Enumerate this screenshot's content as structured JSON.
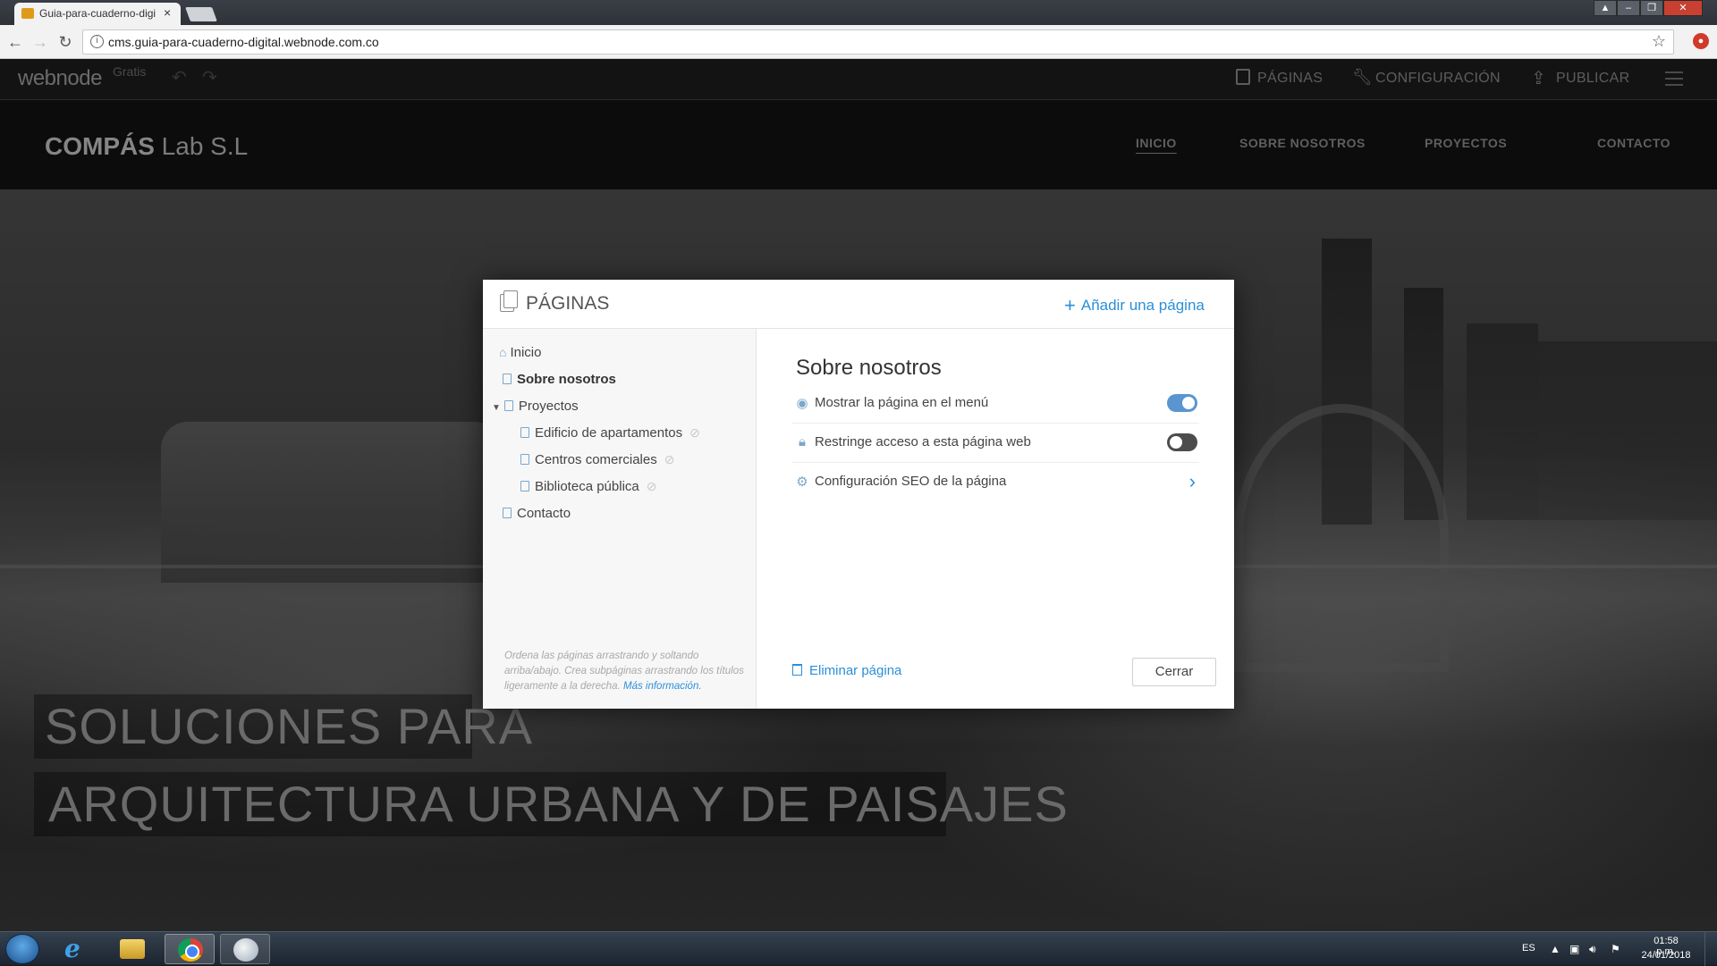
{
  "browser": {
    "tab_title": "Guia-para-cuaderno-digi",
    "tab_close": "×",
    "url": "cms.guia-para-cuaderno-digital.webnode.com.co"
  },
  "editor_bar": {
    "logo": "webnode",
    "plan": "Gratis",
    "undo": "↶",
    "redo": "↷",
    "pages": "PÁGINAS",
    "settings": "CONFIGURACIÓN",
    "publish": "PUBLICAR"
  },
  "site": {
    "brand_bold": "COMPÁS",
    "brand_rest": " Lab S.L",
    "nav": [
      "INICIO",
      "SOBRE NOSOTROS",
      "PROYECTOS",
      "CONTACTO"
    ],
    "hero_line1": "SOLUCIONES PARA",
    "hero_line2": "ARQUITECTURA URBANA Y DE PAISAJES"
  },
  "modal": {
    "title": "PÁGINAS",
    "add_page": "Añadir una página",
    "tree": {
      "inicio": "Inicio",
      "sobre": "Sobre nosotros",
      "proyectos": "Proyectos",
      "edificio": "Edificio de apartamentos",
      "centros": "Centros comerciales",
      "biblioteca": "Biblioteca pública",
      "contacto": "Contacto"
    },
    "help_text": "Ordena las páginas arrastrando y soltando arriba/abajo. Crea subpáginas arrastrando los títulos ligeramente a la derecha.",
    "help_link": "Más información.",
    "selected_page": "Sobre nosotros",
    "options": {
      "show_in_menu": "Mostrar la página en el menú",
      "show_in_menu_on": true,
      "restrict_access": "Restringe acceso a esta página web",
      "restrict_access_on": false,
      "seo": "Configuración SEO de la página"
    },
    "delete_page": "Eliminar página",
    "close": "Cerrar"
  },
  "taskbar": {
    "lang": "ES",
    "time": "01:58 p.m.",
    "date": "24/01/2018"
  },
  "colors": {
    "accent": "#2b8fd8",
    "toggle_on": "#5b95d0",
    "toggle_off": "#4c4c4c"
  }
}
